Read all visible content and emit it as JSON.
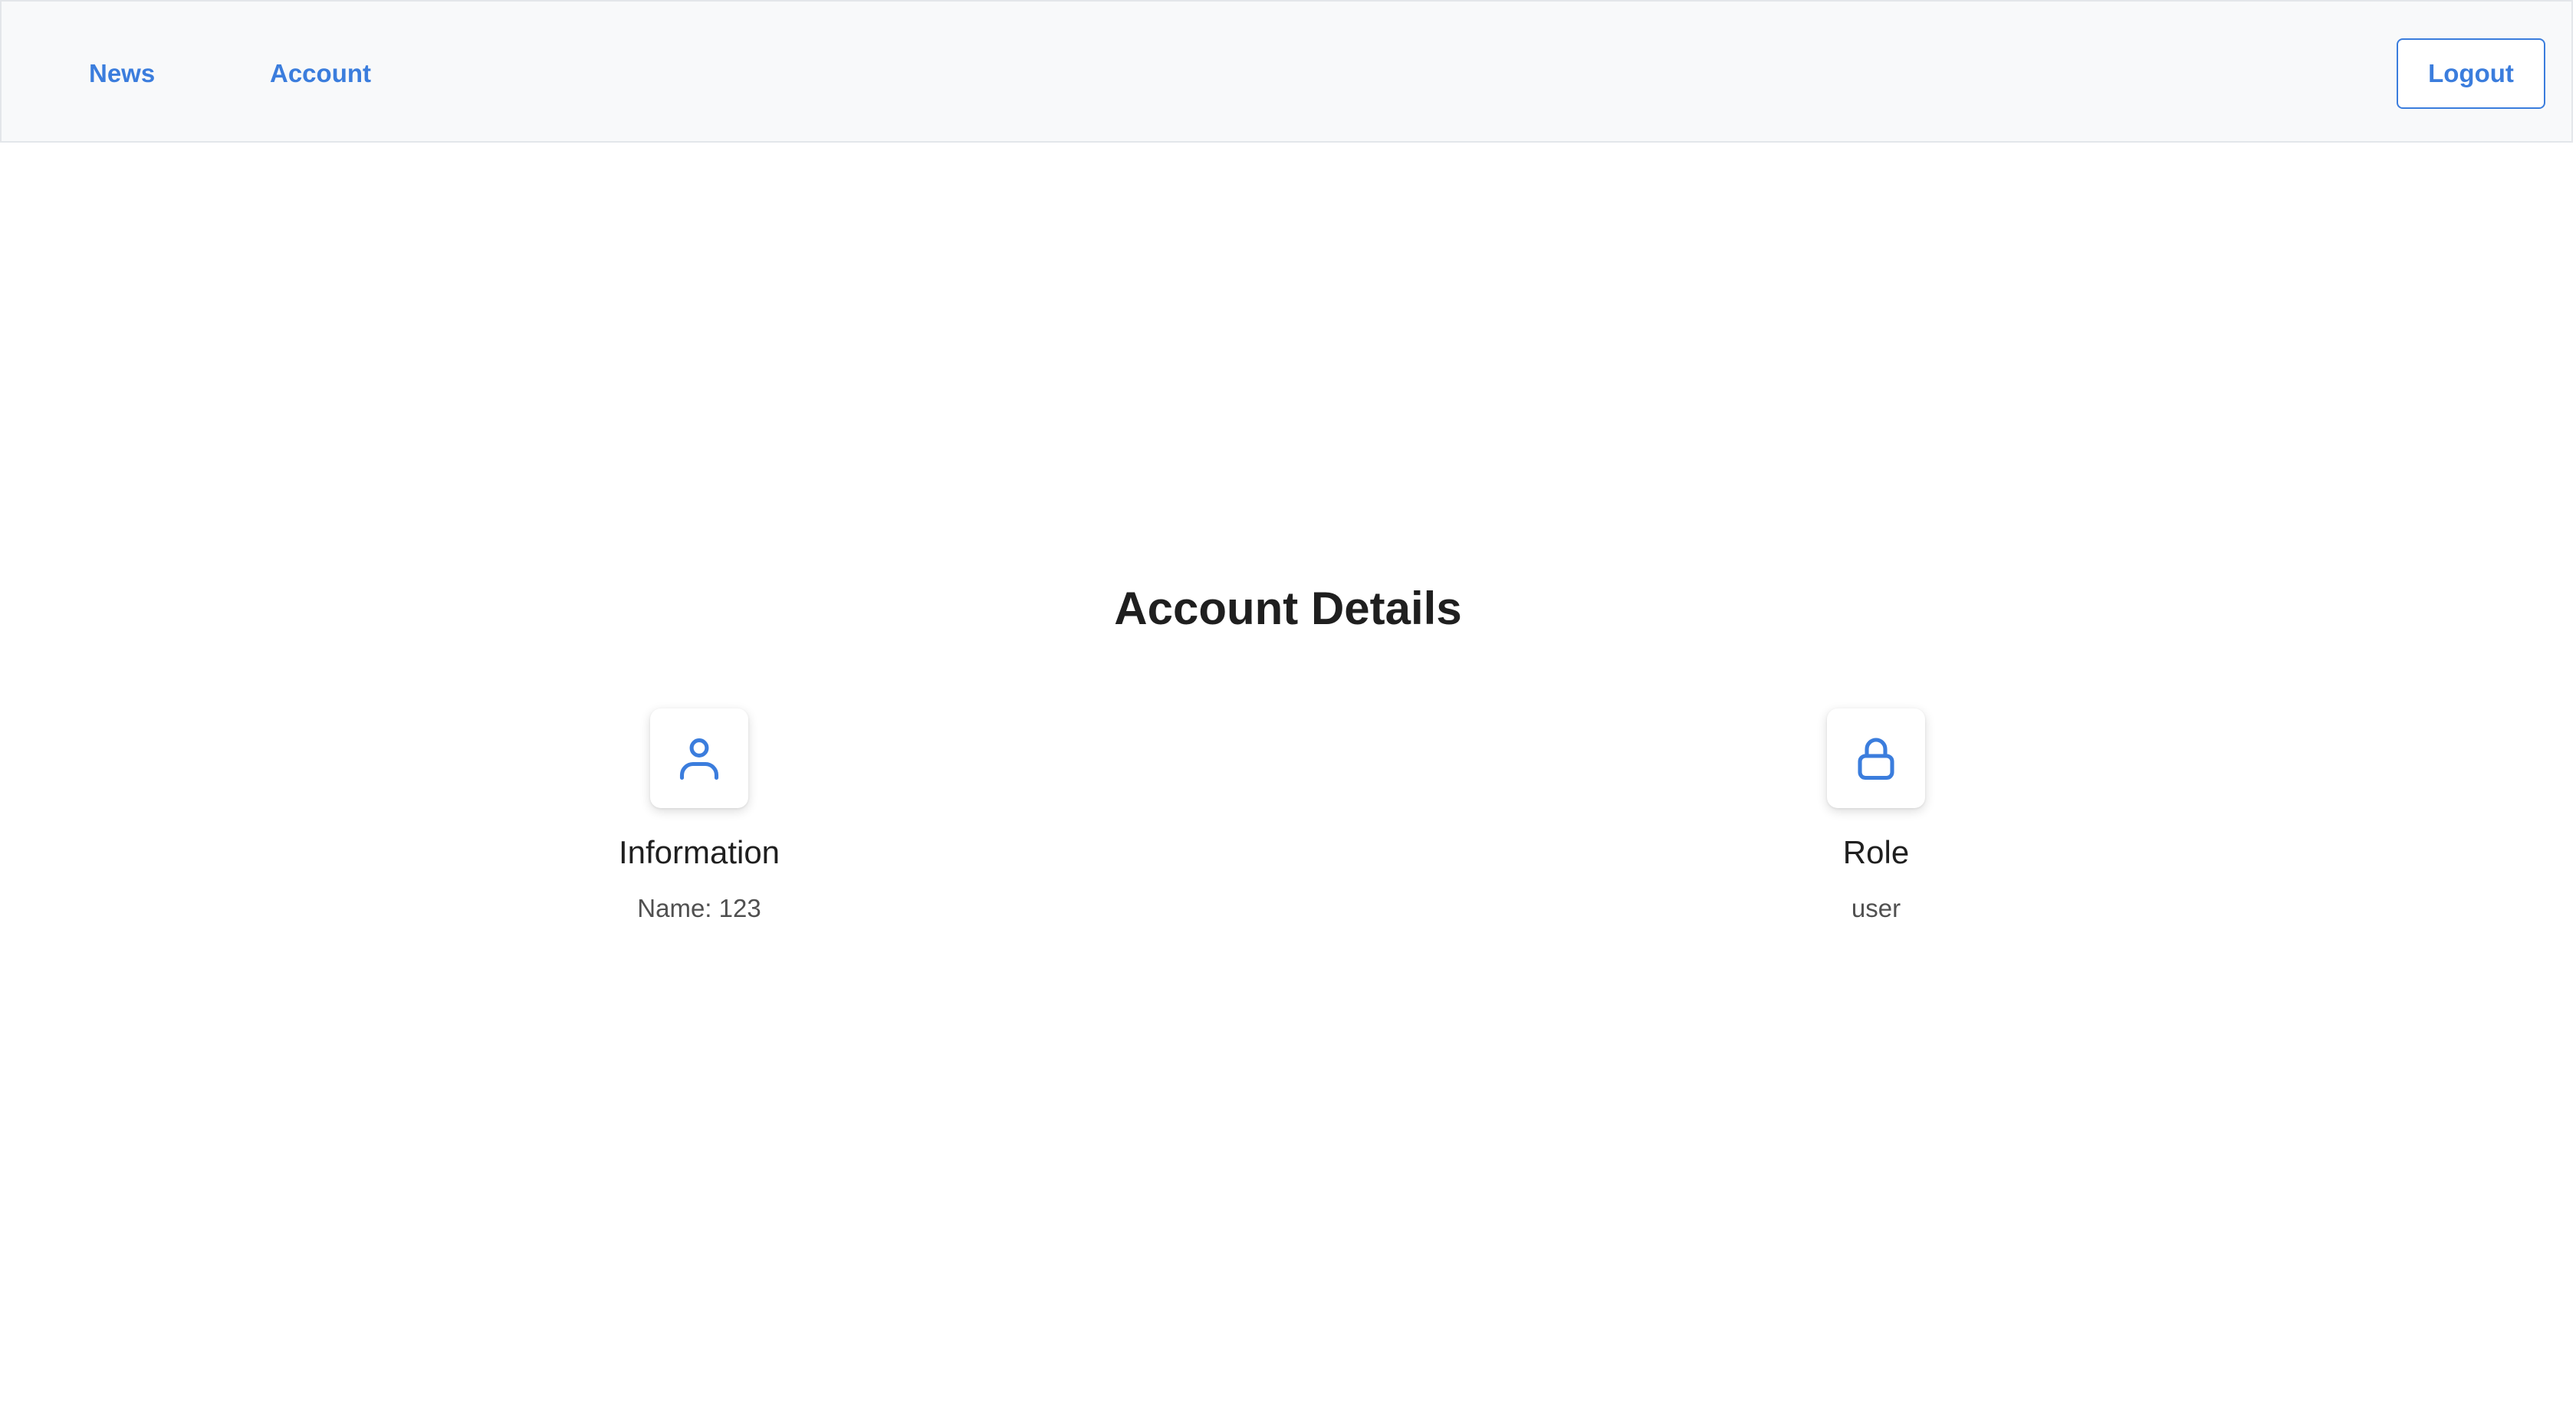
{
  "navbar": {
    "links": [
      {
        "label": "News"
      },
      {
        "label": "Account"
      }
    ],
    "logout_label": "Logout"
  },
  "main": {
    "title": "Account Details",
    "cards": [
      {
        "icon": "user-icon",
        "title": "Information",
        "text": "Name: 123"
      },
      {
        "icon": "lock-icon",
        "title": "Role",
        "text": "user"
      }
    ]
  },
  "colors": {
    "accent": "#3b7ddd",
    "navbar_bg": "#f8f9fa",
    "title_text": "#1f1f1f",
    "body_text": "#505050"
  }
}
